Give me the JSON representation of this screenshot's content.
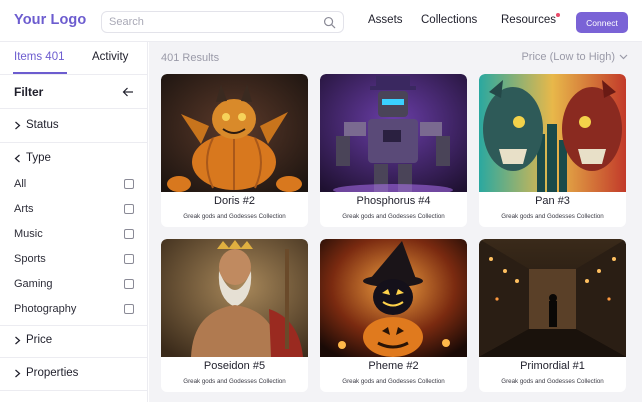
{
  "header": {
    "logo": "Your Logo",
    "search_placeholder": "Search",
    "nav": [
      "Assets",
      "Collections",
      "Resources"
    ],
    "connect_label": "Connect",
    "accent_color": "#7a63d6",
    "notification_dot_color": "#e94b6a"
  },
  "sidebar": {
    "tabs": [
      {
        "label": "Items 401",
        "active": true
      },
      {
        "label": "Activity",
        "active": false
      }
    ],
    "filter_title": "Filter",
    "sections": {
      "status": "Status",
      "type": "Type",
      "price": "Price",
      "properties": "Properties"
    },
    "type_options": [
      {
        "label": "All",
        "checked": false
      },
      {
        "label": "Arts",
        "checked": false
      },
      {
        "label": "Music",
        "checked": false
      },
      {
        "label": "Sports",
        "checked": false
      },
      {
        "label": "Gaming",
        "checked": false
      },
      {
        "label": "Photography",
        "checked": false
      }
    ]
  },
  "main": {
    "results_label": "401 Results",
    "sort_label": "Price (Low to High)",
    "cards": [
      {
        "title": "Doris #2",
        "collection": "Greak gods and Godesses Collection",
        "art": "pumpkin-dragon"
      },
      {
        "title": "Phosphorus #4",
        "collection": "Greak gods and Godesses Collection",
        "art": "purple-robot"
      },
      {
        "title": "Pan #3",
        "collection": "Greak gods and Godesses Collection",
        "art": "twin-demons"
      },
      {
        "title": "Poseidon #5",
        "collection": "Greak gods and Godesses Collection",
        "art": "bearded-god"
      },
      {
        "title": "Pheme #2",
        "collection": "Greak gods and Godesses Collection",
        "art": "witch-pumpkin"
      },
      {
        "title": "Primordial #1",
        "collection": "Greak gods and Godesses Collection",
        "art": "dark-city-street"
      }
    ]
  }
}
